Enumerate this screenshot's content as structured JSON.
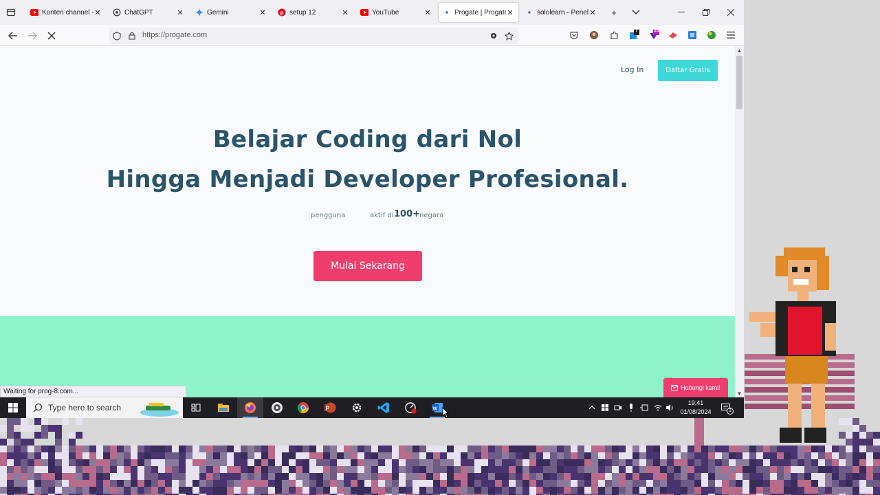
{
  "browser": {
    "tabs": [
      {
        "title": "Konten channel -",
        "icon": "youtube-icon",
        "color": "#ff0000"
      },
      {
        "title": "ChatGPT",
        "icon": "chatgpt-icon",
        "color": "#333333"
      },
      {
        "title": "Gemini",
        "icon": "gemini-icon",
        "color": "#4285f4"
      },
      {
        "title": "setup 12",
        "icon": "pinterest-icon",
        "color": "#e60023"
      },
      {
        "title": "YouTube",
        "icon": "youtube-icon",
        "color": "#ff0000"
      },
      {
        "title": "Progate | Progate",
        "icon": "loading-dot-icon",
        "color": "#0060df"
      },
      {
        "title": "sololearn - Penelu",
        "icon": "loading-dot-icon",
        "color": "#0060df"
      }
    ],
    "close_glyph": "✕",
    "new_tab_glyph": "+",
    "url": "https://progate.com",
    "extension_badges": {
      "first": "7",
      "second": "16"
    }
  },
  "page": {
    "login_label": "Log In",
    "signup_label": "Daftar Gratis",
    "hero_line1": "Belajar Coding dari Nol",
    "hero_line2": "Hingga Menjadi Developer Profesional.",
    "stat_users_label": "pengguna",
    "stat_active_prefix": "aktif di",
    "stat_countries_value": "100+",
    "stat_countries_suffix": "negara",
    "cta_label": "Mulai Sekarang",
    "contact_label": "Hubungi kami!",
    "status_text": "Waiting for prog-8.com...",
    "colors": {
      "teal": "#3fd8d8",
      "pink": "#ef3e6e",
      "mint": "#8ff2cb",
      "navy": "#2b546a"
    }
  },
  "taskbar": {
    "search_placeholder": "Type here to search",
    "time": "19:41",
    "date": "01/08/2024",
    "notification_count": "3"
  }
}
